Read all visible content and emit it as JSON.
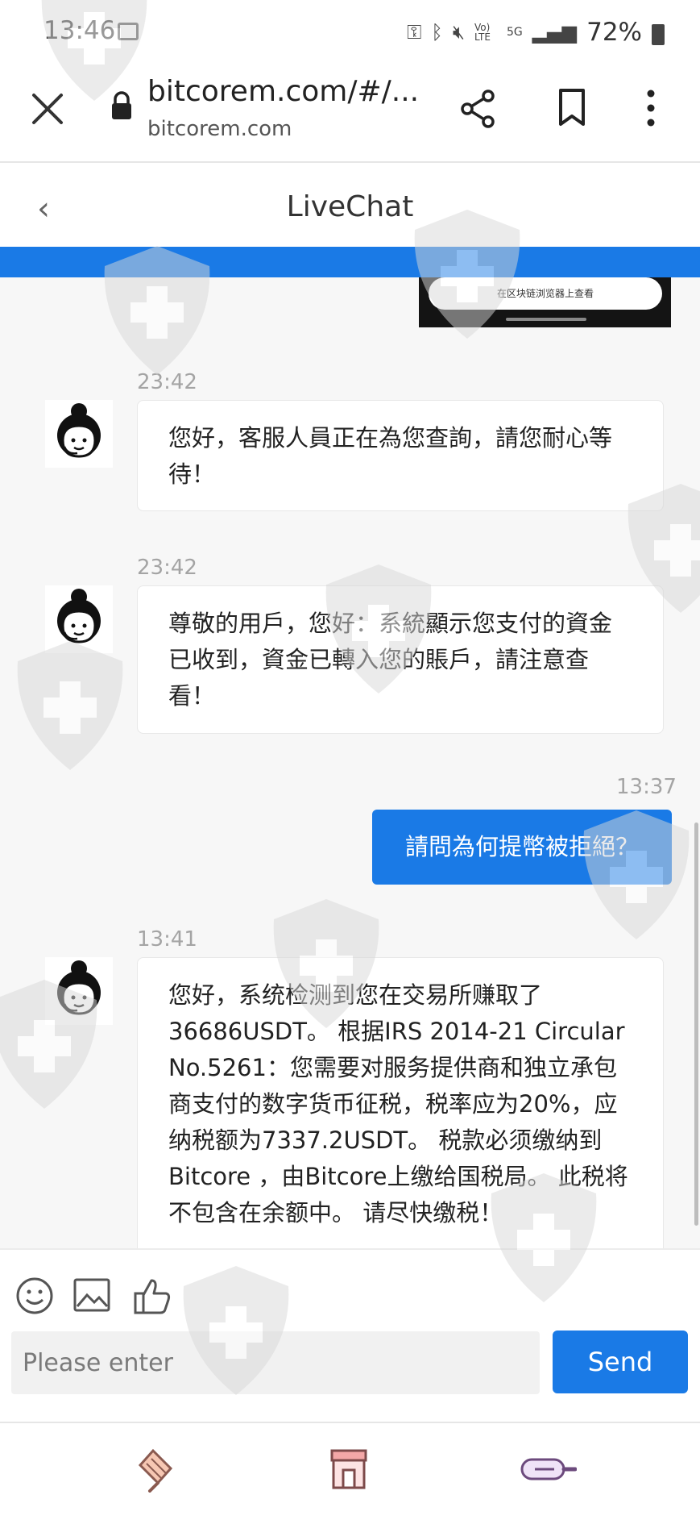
{
  "status_bar": {
    "time": "13:46",
    "network_volte": "Vo) LTE",
    "network_5g": "5G",
    "battery": "72%"
  },
  "browser": {
    "url_main": "bitcorem.com/#/...",
    "url_sub": "bitcorem.com"
  },
  "chat": {
    "title": "LiveChat",
    "image_button_label": "在区块链浏览器上查看",
    "messages": [
      {
        "time": "23:42",
        "text": "您好，客服人員正在為您查詢，請您耐心等待！"
      },
      {
        "time": "23:42",
        "text": "尊敬的用戶，您好：系統顯示您支付的資金已收到，資金已轉入您的賬戶，請注意查看！"
      },
      {
        "time": "13:37",
        "text": "請問為何提幣被拒絕？"
      },
      {
        "time": "13:41",
        "text": "您好，系统检测到您在交易所赚取了36686USDT。 根据IRS 2014-21 Circular No.5261：您需要对服务提供商和独立承包商支付的数字货币征税，税率应为20%，应纳税额为7337.2USDT。 税款必须缴纳到Bitcore ，由Bitcore上缴给国税局。 此税将不包含在余额中。 请尽快缴税！"
      }
    ]
  },
  "input": {
    "placeholder": "Please enter",
    "send_label": "Send"
  },
  "colors": {
    "accent": "#1a7ae6",
    "timestamp": "#a4a4a4"
  }
}
